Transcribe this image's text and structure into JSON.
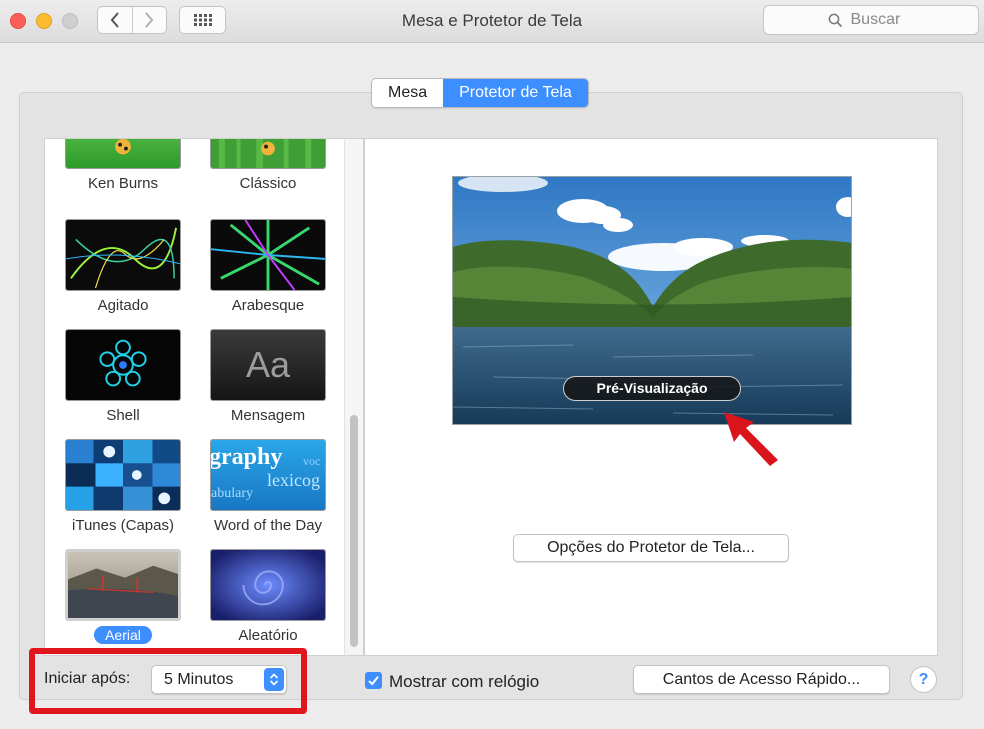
{
  "window": {
    "title": "Mesa e Protetor de Tela",
    "search_placeholder": "Buscar"
  },
  "tabs": [
    {
      "label": "Mesa",
      "active": false
    },
    {
      "label": "Protetor de Tela",
      "active": true
    }
  ],
  "screensavers": [
    {
      "label": "Ken Burns",
      "selected": false
    },
    {
      "label": "Clássico",
      "selected": false
    },
    {
      "label": "Agitado",
      "selected": false
    },
    {
      "label": "Arabesque",
      "selected": false
    },
    {
      "label": "Shell",
      "selected": false
    },
    {
      "label": "Mensagem",
      "selected": false,
      "thumb_text": "Aa"
    },
    {
      "label": "iTunes (Capas)",
      "selected": false
    },
    {
      "label": "Word of the Day",
      "selected": false,
      "thumb_words": [
        "graphy",
        "voc",
        "lexicog",
        "abulary"
      ]
    },
    {
      "label": "Aerial",
      "selected": true
    },
    {
      "label": "Aleatório",
      "selected": false
    }
  ],
  "preview": {
    "button_label": "Pré-Visualização"
  },
  "options_button": "Opções do Protetor de Tela...",
  "start_after": {
    "label": "Iniciar após:",
    "value": "5 Minutos"
  },
  "show_clock": {
    "label": "Mostrar com relógio",
    "checked": true
  },
  "hot_corners_button": "Cantos de Acesso Rápido...",
  "help_label": "?",
  "colors": {
    "accent": "#3d8eff",
    "highlight_frame": "#e0161c",
    "arrow": "#d9141b"
  }
}
